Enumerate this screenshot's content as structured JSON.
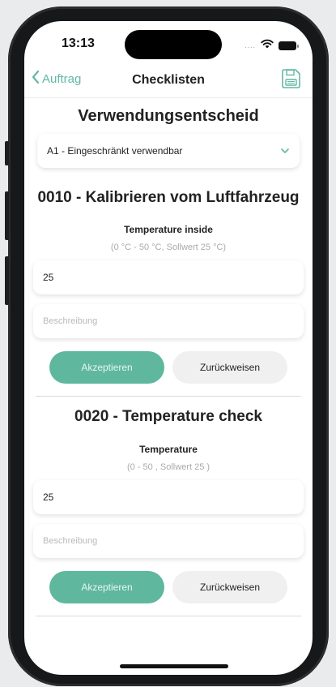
{
  "status_bar": {
    "time": "13:13",
    "signal": "....",
    "icons": [
      "wifi-icon",
      "battery-icon"
    ]
  },
  "nav": {
    "back_label": "Auftrag",
    "title": "Checklisten",
    "save_icon": "save-icon"
  },
  "decision": {
    "heading": "Verwendungsentscheid",
    "selected": "A1 - Eingeschränkt verwendbar"
  },
  "checklist": [
    {
      "title": "0010 - Kalibrieren vom Luftfahrzeug",
      "label": "Temperature inside",
      "range": "(0 °C - 50 °C, Sollwert 25 °C)",
      "value": "25",
      "description_placeholder": "Beschreibung",
      "accept_label": "Akzeptieren",
      "reject_label": "Zurückweisen"
    },
    {
      "title": "0020 - Temperature check",
      "label": "Temperature",
      "range": "(0  - 50 , Sollwert 25 )",
      "value": "25",
      "description_placeholder": "Beschreibung",
      "accept_label": "Akzeptieren",
      "reject_label": "Zurückweisen"
    }
  ],
  "colors": {
    "accent": "#62b8a3",
    "accept_button": "#5fb89e",
    "reject_button": "#f0f0f0"
  }
}
